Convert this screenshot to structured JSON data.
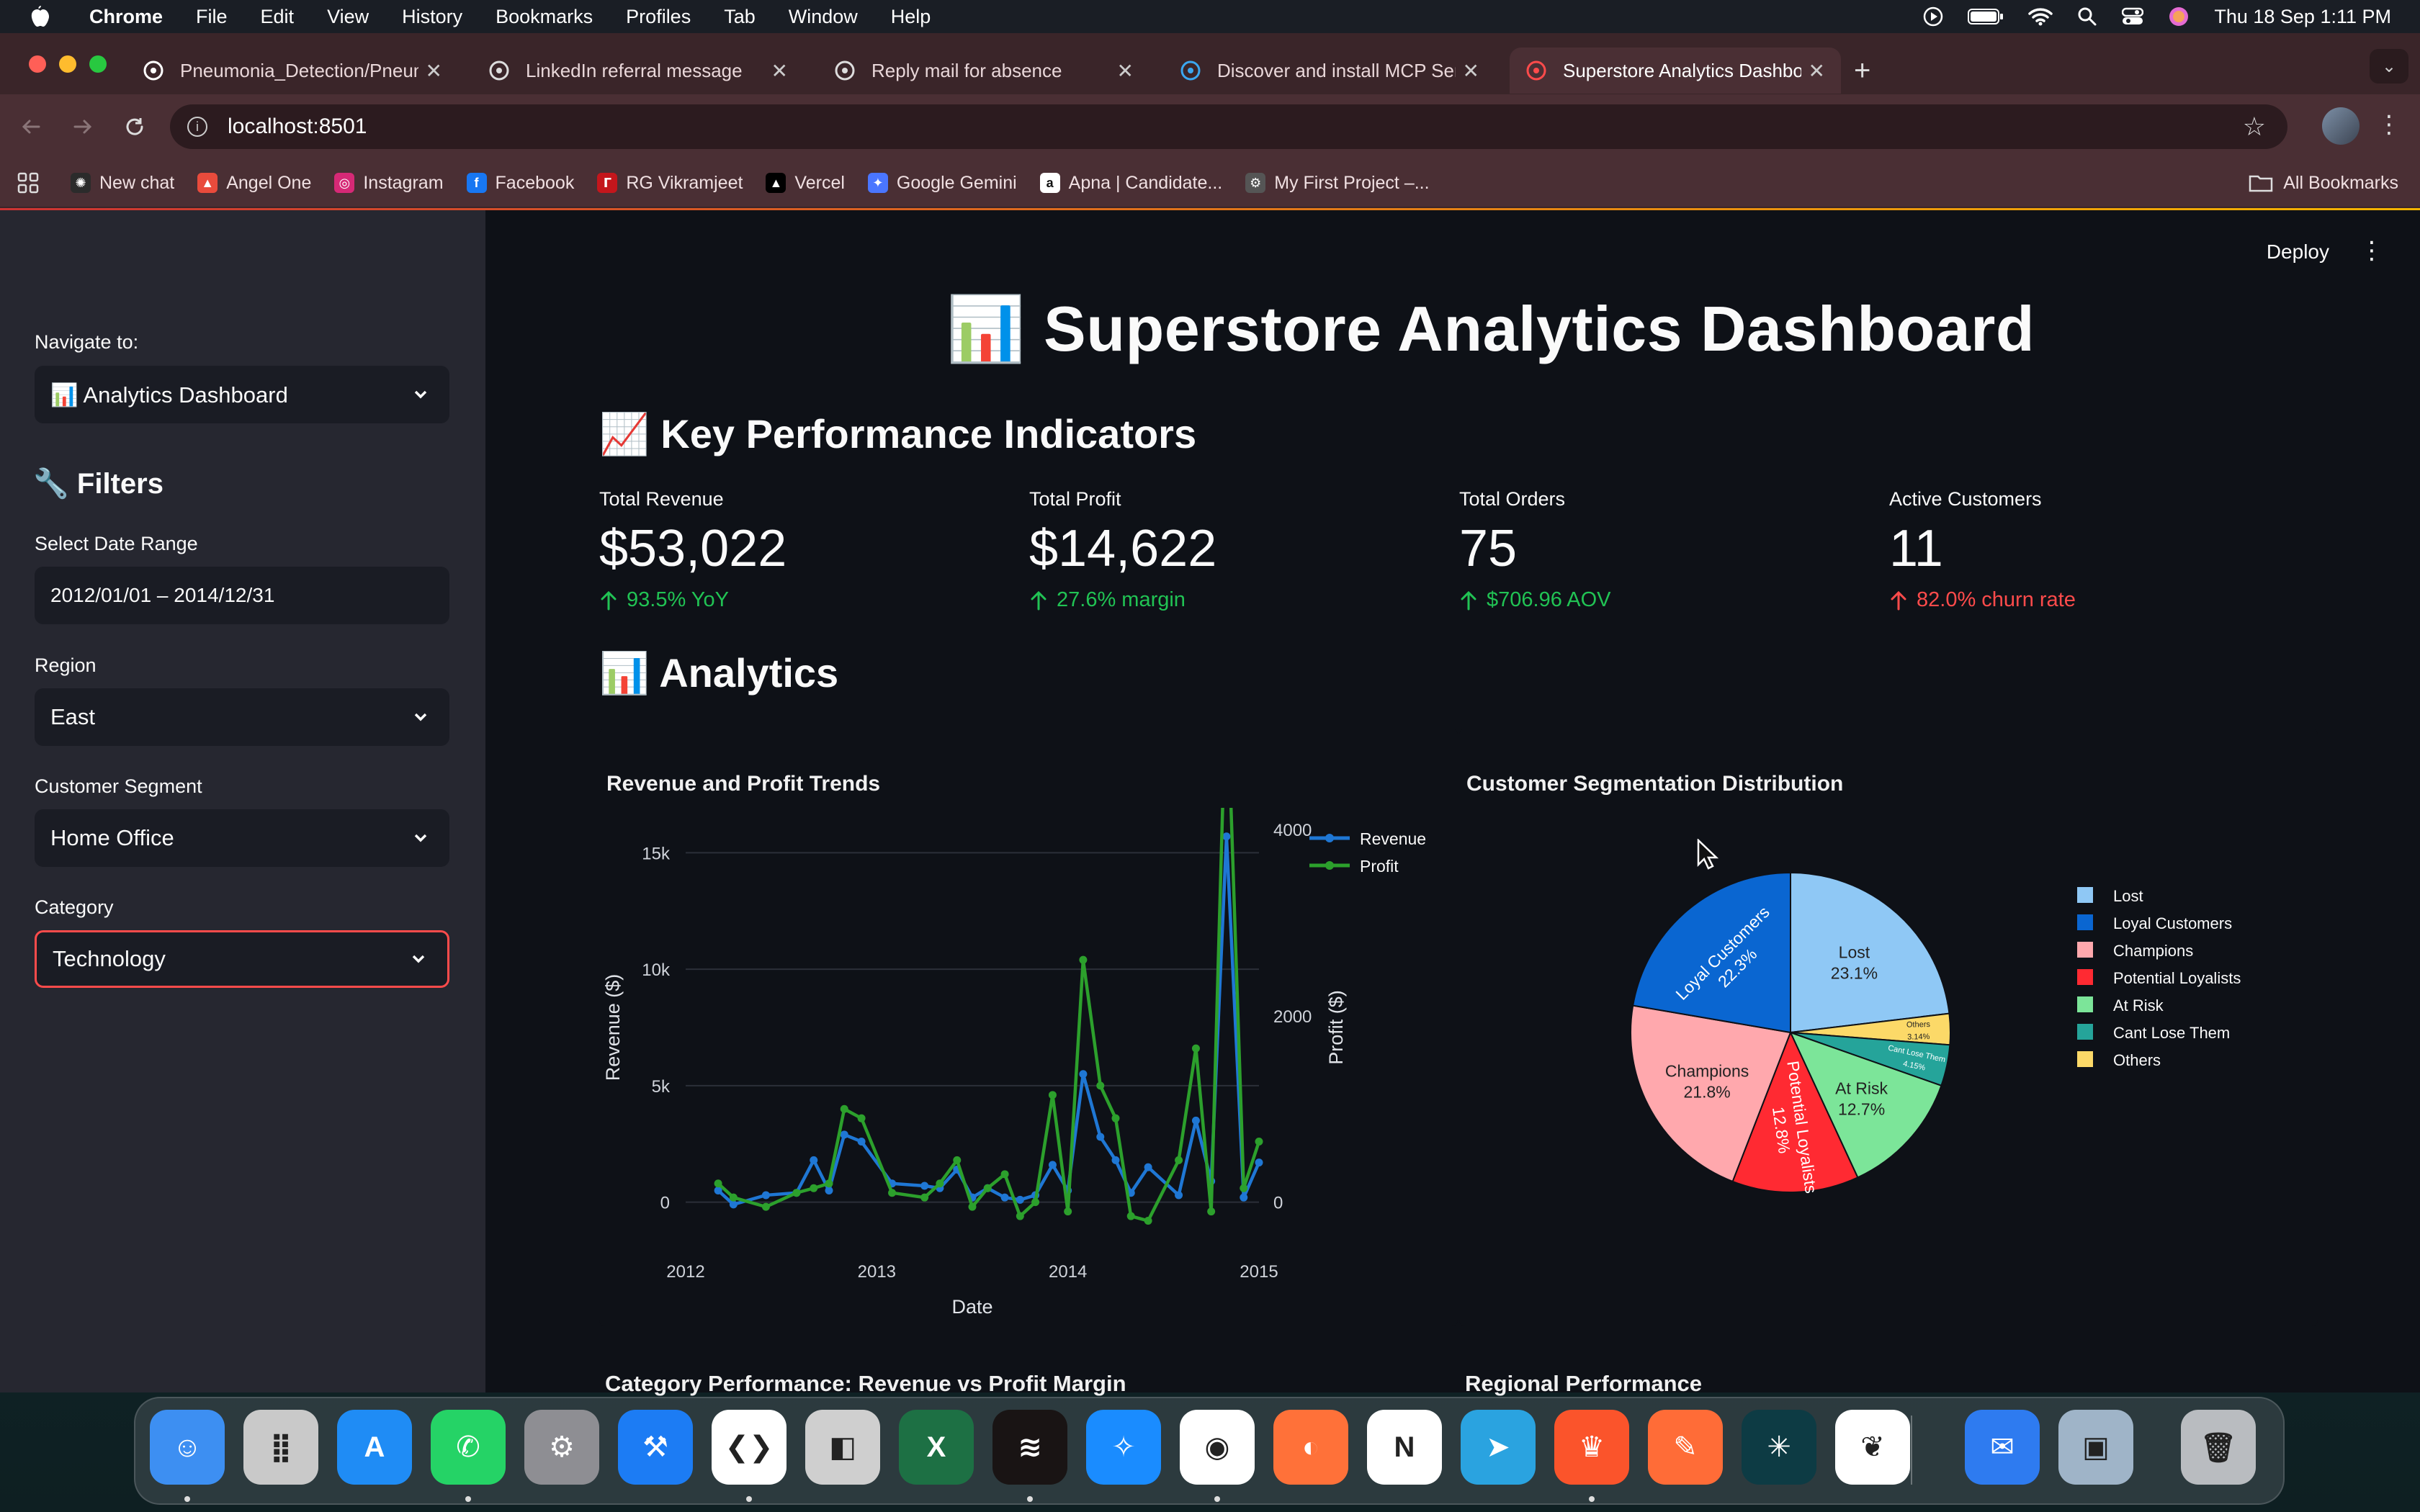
{
  "menubar": {
    "apple": "",
    "app_name": "Chrome",
    "menus": [
      "File",
      "Edit",
      "View",
      "History",
      "Bookmarks",
      "Profiles",
      "Tab",
      "Window",
      "Help"
    ],
    "datetime": "Thu 18 Sep  1:11 PM"
  },
  "browser": {
    "tabs": [
      {
        "title": "Pneumonia_Detection/Pneum",
        "icon": "github-icon"
      },
      {
        "title": "LinkedIn referral message",
        "icon": "chatgpt-icon"
      },
      {
        "title": "Reply mail for absence",
        "icon": "chatgpt-icon"
      },
      {
        "title": "Discover and install MCP Ser",
        "icon": "vscode-icon"
      },
      {
        "title": "Superstore Analytics Dashboa",
        "icon": "chart-icon"
      }
    ],
    "url": "localhost:8501",
    "bookmarks": [
      {
        "label": "New chat",
        "color": "#2b2b2b",
        "glyph": "✺"
      },
      {
        "label": "Angel One",
        "color": "#e94b3c",
        "glyph": "▲"
      },
      {
        "label": "Instagram",
        "color": "#d62976",
        "glyph": "◎"
      },
      {
        "label": "Facebook",
        "color": "#1877f2",
        "glyph": "f"
      },
      {
        "label": "RG Vikramjeet",
        "color": "#c4161c",
        "glyph": "ᒥ"
      },
      {
        "label": "Vercel",
        "color": "#000000",
        "glyph": "▲"
      },
      {
        "label": "Google Gemini",
        "color": "#4a76ff",
        "glyph": "✦"
      },
      {
        "label": "Apna | Candidate...",
        "color": "#ffffff",
        "glyph": "a"
      },
      {
        "label": "My First Project –...",
        "color": "#555555",
        "glyph": "⚙"
      }
    ],
    "all_bookmarks": "All Bookmarks"
  },
  "sidebar": {
    "navigate_label": "Navigate to:",
    "navigate_value": "📊 Analytics Dashboard",
    "filters_heading": "🔧 Filters",
    "date_label": "Select Date Range",
    "date_value": "2012/01/01 – 2014/12/31",
    "region_label": "Region",
    "region_value": "East",
    "segment_label": "Customer Segment",
    "segment_value": "Home Office",
    "category_label": "Category",
    "category_value": "Technology"
  },
  "main": {
    "deploy": "Deploy",
    "title": "📊 Superstore Analytics Dashboard",
    "kpi_heading": "📈 Key Performance Indicators",
    "analytics_heading": "📊 Analytics",
    "kpis": [
      {
        "label": "Total Revenue",
        "value": "$53,022",
        "delta": "93.5% YoY",
        "delta_color": "#21c354"
      },
      {
        "label": "Total Profit",
        "value": "$14,622",
        "delta": "27.6% margin",
        "delta_color": "#21c354"
      },
      {
        "label": "Total Orders",
        "value": "75",
        "delta": "$706.96 AOV",
        "delta_color": "#21c354"
      },
      {
        "label": "Active Customers",
        "value": "11",
        "delta": "82.0% churn rate",
        "delta_color": "#ff4b4b"
      }
    ],
    "next_section_left": "Category Performance: Revenue vs Profit Margin",
    "next_section_right": "Regional Performance"
  },
  "chart_data": [
    {
      "type": "line",
      "title": "Revenue and Profit Trends",
      "xlabel": "Date",
      "ylabel": "Revenue ($)",
      "y2label": "Profit ($)",
      "x_ticks": [
        "2012",
        "2013",
        "2014",
        "2015"
      ],
      "xlim": [
        2012.0,
        2015.0
      ],
      "y_ticks": [
        "0",
        "5k",
        "10k",
        "15k"
      ],
      "ylim": [
        -1000,
        16000
      ],
      "y2_ticks": [
        "0",
        "2000",
        "4000"
      ],
      "y2lim": [
        -250,
        4000
      ],
      "legend_position": "top-right",
      "series": [
        {
          "name": "Revenue",
          "color": "#1f77d4",
          "axis": "left",
          "x": [
            2012.17,
            2012.25,
            2012.42,
            2012.58,
            2012.67,
            2012.75,
            2012.83,
            2012.92,
            2013.08,
            2013.25,
            2013.33,
            2013.42,
            2013.5,
            2013.58,
            2013.67,
            2013.75,
            2013.83,
            2013.92,
            2014.0,
            2014.08,
            2014.17,
            2014.25,
            2014.33,
            2014.42,
            2014.58,
            2014.67,
            2014.75,
            2014.83,
            2014.92,
            2015.0
          ],
          "y": [
            500,
            -100,
            300,
            400,
            1800,
            500,
            2900,
            2600,
            800,
            700,
            600,
            1400,
            200,
            600,
            200,
            100,
            300,
            1600,
            500,
            5500,
            2800,
            1800,
            400,
            1500,
            300,
            3500,
            900,
            15700,
            200,
            1700
          ]
        },
        {
          "name": "Profit",
          "color": "#2ca02c",
          "axis": "right",
          "x": [
            2012.17,
            2012.25,
            2012.42,
            2012.58,
            2012.67,
            2012.75,
            2012.83,
            2012.92,
            2013.08,
            2013.25,
            2013.33,
            2013.42,
            2013.5,
            2013.58,
            2013.67,
            2013.75,
            2013.83,
            2013.92,
            2014.0,
            2014.08,
            2014.17,
            2014.25,
            2014.33,
            2014.42,
            2014.58,
            2014.67,
            2014.75,
            2014.83,
            2014.92,
            2015.0
          ],
          "y": [
            200,
            50,
            -50,
            100,
            150,
            200,
            1000,
            900,
            100,
            50,
            200,
            450,
            -50,
            150,
            300,
            -150,
            0,
            1150,
            -100,
            2600,
            1250,
            900,
            -150,
            -200,
            450,
            1650,
            -100,
            5700,
            150,
            650
          ]
        }
      ]
    },
    {
      "type": "pie",
      "title": "Customer Segmentation Distribution",
      "legend_position": "right",
      "slices": [
        {
          "label": "Lost",
          "value": 23.1,
          "color": "#8fc8f5"
        },
        {
          "label": "Loyal Customers",
          "value": 22.3,
          "color": "#0a66d1"
        },
        {
          "label": "Champions",
          "value": 21.8,
          "color": "#ffa8ad"
        },
        {
          "label": "Potential Loyalists",
          "value": 12.8,
          "color": "#ff2a32"
        },
        {
          "label": "At Risk",
          "value": 12.7,
          "color": "#7ce599"
        },
        {
          "label": "Cant Lose Them",
          "value": 4.15,
          "color": "#25a49a"
        },
        {
          "label": "Others",
          "value": 3.14,
          "color": "#fcd968"
        }
      ],
      "slice_text": [
        {
          "name": "Lost",
          "pct": "23.1%"
        },
        {
          "name": "Loyal Customers",
          "pct": "22.3%"
        },
        {
          "name": "Champions",
          "pct": "21.8%"
        },
        {
          "name": "Potential Loyalists",
          "pct": "12.8%"
        },
        {
          "name": "At Risk",
          "pct": "12.7%"
        },
        {
          "name": "Cant Lose Them",
          "pct": "4.15%"
        },
        {
          "name": "Others",
          "pct": "3.14%"
        }
      ]
    }
  ],
  "dock": {
    "apps": [
      {
        "name": "finder-icon",
        "color": "#3d8ff2",
        "glyph": "☺"
      },
      {
        "name": "launchpad-icon",
        "color": "#c9c9c9",
        "glyph": "⣿"
      },
      {
        "name": "app-store-icon",
        "color": "#1f8cf5",
        "glyph": "A"
      },
      {
        "name": "whatsapp-icon",
        "color": "#25d366",
        "glyph": "✆"
      },
      {
        "name": "system-settings-icon",
        "color": "#8e8e93",
        "glyph": "⚙"
      },
      {
        "name": "xcode-icon",
        "color": "#1c7cf4",
        "glyph": "⚒"
      },
      {
        "name": "vscode-icon",
        "color": "#ffffff",
        "glyph": "❮❯"
      },
      {
        "name": "rectangle-icon",
        "color": "#cfcfcf",
        "glyph": "◧"
      },
      {
        "name": "excel-icon",
        "color": "#1d7044",
        "glyph": "X"
      },
      {
        "name": "spotify-icon",
        "color": "#191414",
        "glyph": "≋"
      },
      {
        "name": "safari-icon",
        "color": "#1a8cff",
        "glyph": "✧"
      },
      {
        "name": "chrome-icon",
        "color": "#ffffff",
        "glyph": "◉"
      },
      {
        "name": "firefox-icon",
        "color": "#ff7139",
        "glyph": "◐"
      },
      {
        "name": "notion-icon",
        "color": "#ffffff",
        "glyph": "N"
      },
      {
        "name": "telegram-icon",
        "color": "#2aa3e0",
        "glyph": "➤"
      },
      {
        "name": "brave-icon",
        "color": "#fb542b",
        "glyph": "♛"
      },
      {
        "name": "postman-icon",
        "color": "#ff6c37",
        "glyph": "✎"
      },
      {
        "name": "perplexity-icon",
        "color": "#0d3b44",
        "glyph": "✳"
      },
      {
        "name": "mongodb-icon",
        "color": "#ffffff",
        "glyph": "❦"
      },
      {
        "name": "mail-icon",
        "color": "#2e7bf0",
        "glyph": "✉"
      },
      {
        "name": "preview-icon",
        "color": "#9fb4c8",
        "glyph": "▣"
      },
      {
        "name": "trash-icon",
        "color": "#b9bcc0",
        "glyph": "🗑"
      }
    ]
  }
}
